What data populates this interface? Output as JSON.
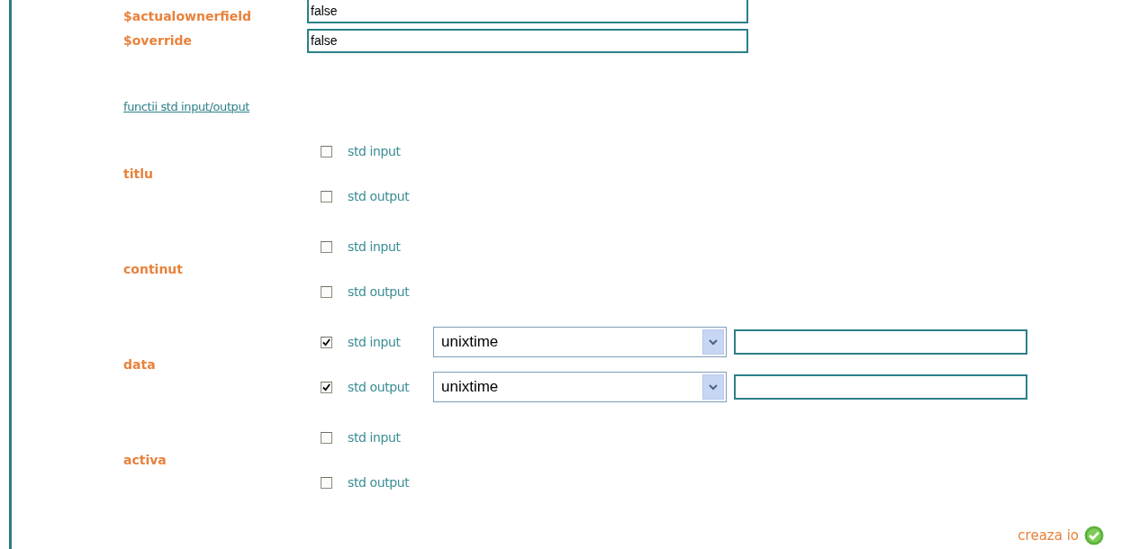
{
  "fields": [
    {
      "label": "$actualownerfield",
      "value": "false"
    },
    {
      "label": "$override",
      "value": "false"
    }
  ],
  "link": "functii std input/output",
  "groups": [
    {
      "label": "titlu",
      "options": [
        {
          "label": "std input",
          "checked": false,
          "kind": "plain"
        },
        {
          "label": "std output",
          "checked": false,
          "kind": "plain"
        }
      ]
    },
    {
      "label": "continut",
      "options": [
        {
          "label": "std input",
          "checked": false,
          "kind": "plain"
        },
        {
          "label": "std output",
          "checked": false,
          "kind": "plain"
        }
      ]
    },
    {
      "label": "data",
      "options": [
        {
          "label": "std input",
          "checked": true,
          "kind": "with-select",
          "select_value": "unixtime"
        },
        {
          "label": "std output",
          "checked": true,
          "kind": "with-select",
          "select_value": "unixtime"
        }
      ]
    },
    {
      "label": "activa",
      "options": [
        {
          "label": "std input",
          "checked": false,
          "kind": "plain"
        },
        {
          "label": "std output",
          "checked": false,
          "kind": "plain"
        }
      ]
    }
  ],
  "submit": "creaza io"
}
